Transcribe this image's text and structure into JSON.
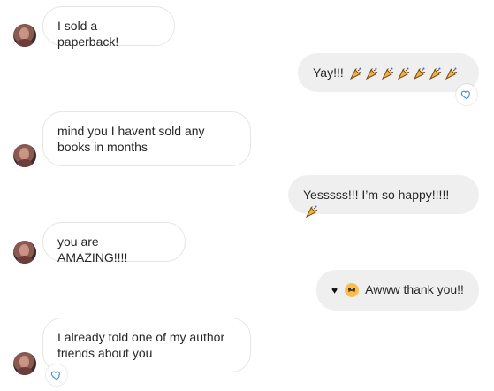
{
  "messages": [
    {
      "text": "I sold a paperback!",
      "direction": "incoming"
    },
    {
      "text": "Yay!!!",
      "direction": "outgoing",
      "emojis": [
        "party-popper-icon",
        "party-popper-icon",
        "party-popper-icon",
        "party-popper-icon",
        "party-popper-icon",
        "party-popper-icon",
        "party-popper-icon"
      ],
      "reaction": "heart-reaction-icon"
    },
    {
      "text": "mind you I havent sold any books in months",
      "direction": "incoming"
    },
    {
      "text": "Yesssss!!! I’m so happy!!!!!",
      "direction": "outgoing",
      "emojis": [
        "party-popper-icon"
      ]
    },
    {
      "text": "you are AMAZING!!!!",
      "direction": "incoming"
    },
    {
      "text": "Awww thank you!!",
      "direction": "outgoing",
      "leading_icons": [
        "black-heart-icon",
        "sad-face-icon"
      ]
    },
    {
      "text": "I already told one of my author friends about you",
      "direction": "incoming",
      "reaction": "heart-reaction-icon"
    }
  ],
  "colors": {
    "incoming_bubble": "#ffffff",
    "outgoing_bubble": "#efefef",
    "border": "#e5e5e5",
    "reaction_heart": "#4a90e2",
    "text": "#262626"
  }
}
